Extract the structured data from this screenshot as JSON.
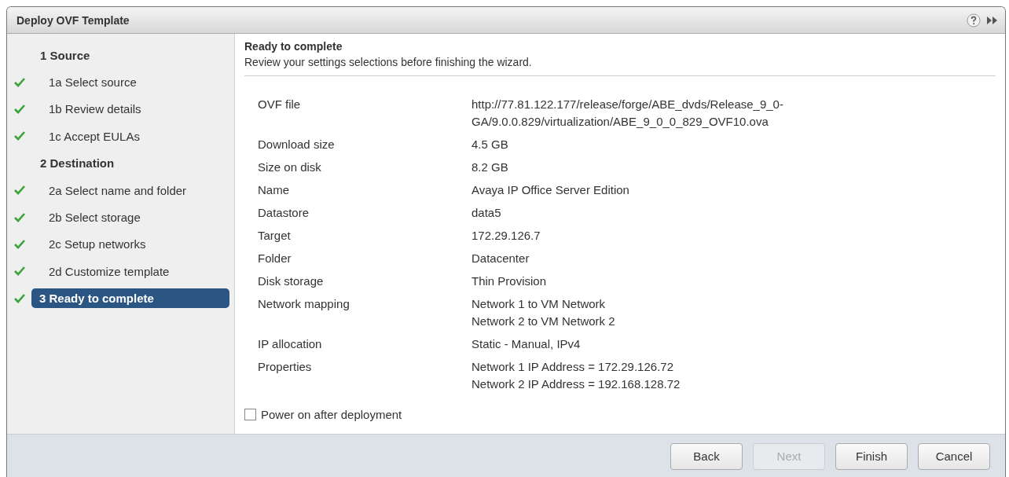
{
  "window": {
    "title": "Deploy OVF Template"
  },
  "steps": [
    {
      "kind": "group",
      "label": "1  Source",
      "done": false,
      "selected": false
    },
    {
      "kind": "step",
      "label": "1a  Select source",
      "done": true,
      "selected": false
    },
    {
      "kind": "step",
      "label": "1b  Review details",
      "done": true,
      "selected": false
    },
    {
      "kind": "step",
      "label": "1c  Accept EULAs",
      "done": true,
      "selected": false
    },
    {
      "kind": "group",
      "label": "2  Destination",
      "done": false,
      "selected": false
    },
    {
      "kind": "step",
      "label": "2a  Select name and folder",
      "done": true,
      "selected": false
    },
    {
      "kind": "step",
      "label": "2b  Select storage",
      "done": true,
      "selected": false
    },
    {
      "kind": "step",
      "label": "2c  Setup networks",
      "done": true,
      "selected": false
    },
    {
      "kind": "step",
      "label": "2d  Customize template",
      "done": true,
      "selected": false
    },
    {
      "kind": "group",
      "label": "3  Ready to complete",
      "done": true,
      "selected": true
    }
  ],
  "page": {
    "title": "Ready to complete",
    "subtitle": "Review your settings selections before finishing the wizard."
  },
  "summary": [
    {
      "label": "OVF file",
      "values": [
        "http://77.81.122.177/release/forge/ABE_dvds/Release_9_0-",
        "GA/9.0.0.829/virtualization/ABE_9_0_0_829_OVF10.ova"
      ]
    },
    {
      "label": "Download size",
      "values": [
        "4.5 GB"
      ]
    },
    {
      "label": "Size on disk",
      "values": [
        "8.2 GB"
      ]
    },
    {
      "label": "Name",
      "values": [
        "Avaya IP Office Server Edition"
      ]
    },
    {
      "label": "Datastore",
      "values": [
        "data5"
      ]
    },
    {
      "label": "Target",
      "values": [
        "172.29.126.7"
      ]
    },
    {
      "label": "Folder",
      "values": [
        "Datacenter"
      ]
    },
    {
      "label": "Disk storage",
      "values": [
        "Thin Provision"
      ]
    },
    {
      "label": "Network mapping",
      "values": [
        "Network 1 to VM Network",
        "Network 2 to VM Network 2"
      ]
    },
    {
      "label": "IP allocation",
      "values": [
        "Static - Manual, IPv4"
      ]
    },
    {
      "label": "Properties",
      "values": [
        "Network 1 IP Address = 172.29.126.72",
        "Network 2 IP Address = 192.168.128.72"
      ]
    }
  ],
  "power_on": {
    "label": "Power on after deployment",
    "checked": false
  },
  "buttons": [
    {
      "label": "Back",
      "disabled": false
    },
    {
      "label": "Next",
      "disabled": true
    },
    {
      "label": "Finish",
      "disabled": false
    },
    {
      "label": "Cancel",
      "disabled": false
    }
  ]
}
